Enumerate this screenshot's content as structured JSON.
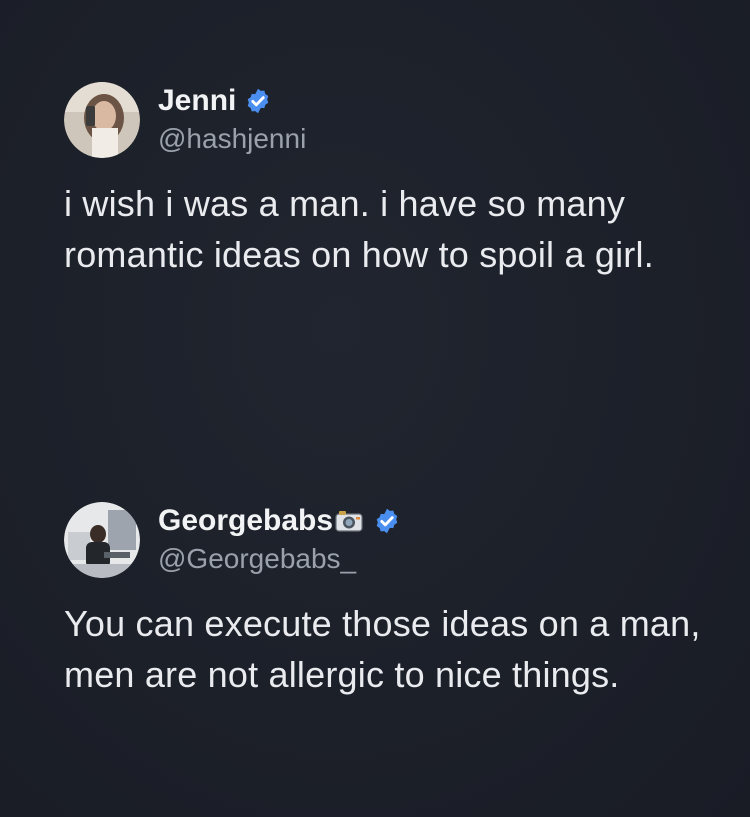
{
  "tweets": [
    {
      "display_name": "Jenni",
      "handle": "@hashjenni",
      "verified": true,
      "avatar_icon": "user-photo-avatar",
      "text": "i wish i was a man. i have so many romantic ideas on how to spoil a girl."
    },
    {
      "display_name": "Georgebabs",
      "handle": "@Georgebabs_",
      "verified": true,
      "name_emoji_icon": "camera-icon",
      "avatar_icon": "user-photo-avatar",
      "text": "You can execute those ideas on a man, men are not allergic to nice things."
    }
  ],
  "colors": {
    "background": "#1b1f2a",
    "text": "#e9ebef",
    "handle": "#9aa1ab",
    "verified_badge": "#4a8ff0"
  }
}
